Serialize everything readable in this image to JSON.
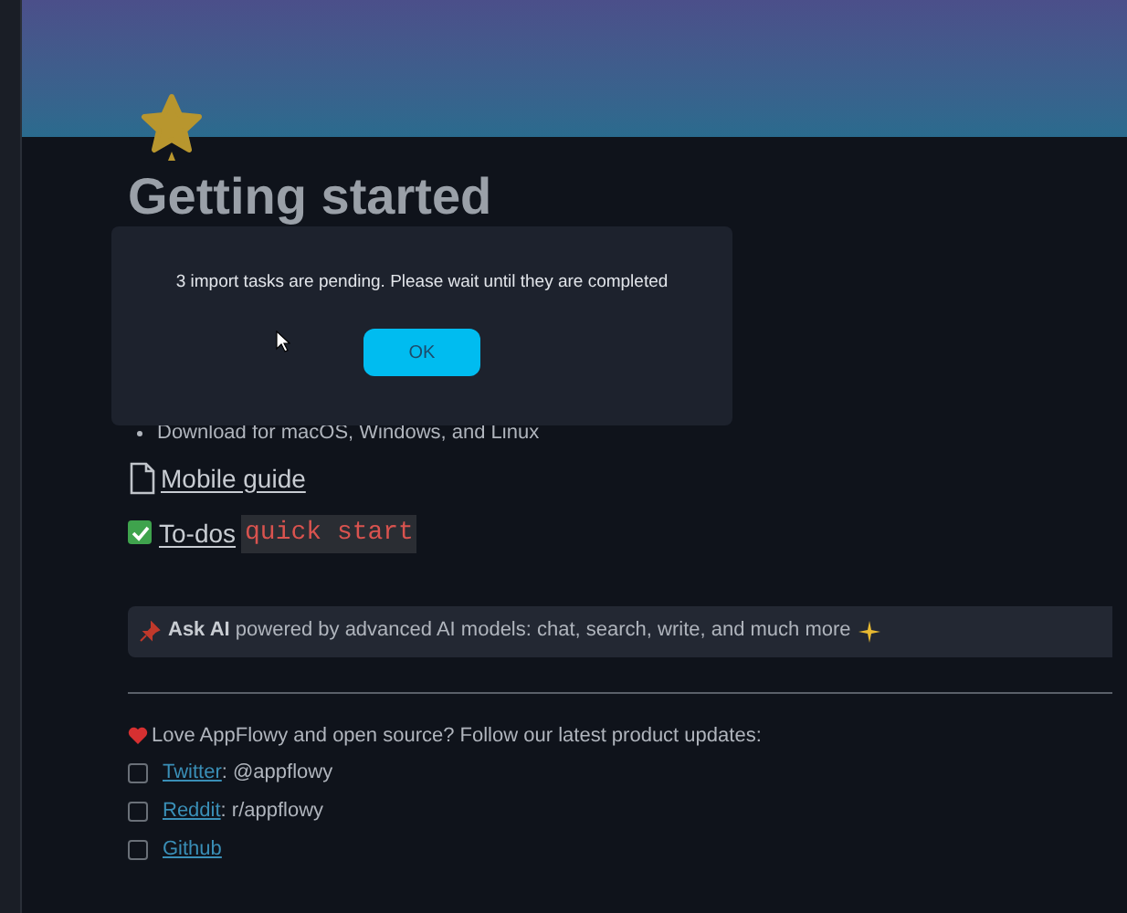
{
  "page": {
    "title": "Getting started",
    "bullet": "Download for macOS, Windows, and Linux",
    "mobile_guide": "Mobile guide",
    "todos": {
      "label": "To-dos",
      "code": "quick start"
    },
    "callout": {
      "bold": "Ask AI",
      "text": "powered by advanced AI models: chat, search, write, and much more"
    },
    "follow_text": "Love AppFlowy and open source? Follow our latest product updates:",
    "checklist": [
      {
        "link": "Twitter",
        "rest": ": @appflowy",
        "checked": false
      },
      {
        "link": "Reddit",
        "rest": ": r/appflowy",
        "checked": false
      },
      {
        "link": "Github",
        "checked": false
      }
    ]
  },
  "dialog": {
    "message": "3 import tasks are pending. Please wait until they are completed",
    "button": "OK"
  }
}
